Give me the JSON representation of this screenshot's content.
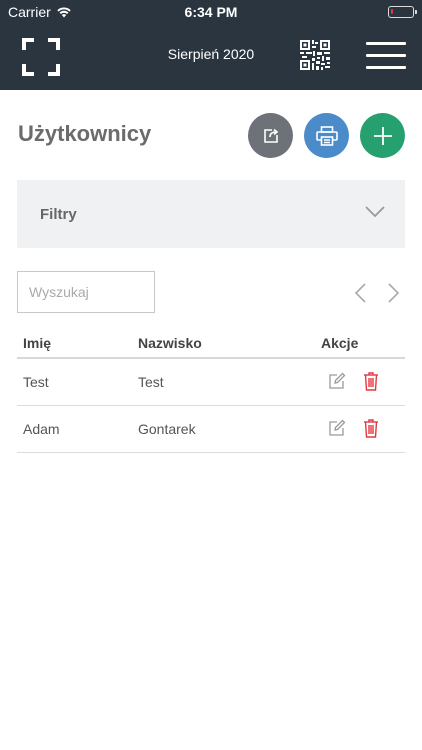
{
  "status_bar": {
    "carrier": "Carrier",
    "time": "6:34 PM",
    "battery_level": 0.1,
    "battery_color": "#e53935"
  },
  "header": {
    "title": "Sierpień 2020",
    "background": "#2b3540",
    "left_icon": "scan-frame-icon",
    "qr_icon": "qr-code-icon",
    "menu_icon": "hamburger-menu-icon"
  },
  "page": {
    "title": "Użytkownicy",
    "actions": [
      {
        "name": "export",
        "icon": "share-export-icon",
        "color": "#6d7279"
      },
      {
        "name": "print",
        "icon": "printer-icon",
        "color": "#4b8bc9"
      },
      {
        "name": "add",
        "icon": "plus-icon",
        "color": "#27a06f"
      }
    ]
  },
  "filters": {
    "label": "Filtry",
    "expanded": false
  },
  "search": {
    "placeholder": "Wyszukaj",
    "value": ""
  },
  "table": {
    "headers": {
      "first_name": "Imię",
      "last_name": "Nazwisko",
      "actions": "Akcje"
    },
    "rows": [
      {
        "first_name": "Test",
        "last_name": "Test"
      },
      {
        "first_name": "Adam",
        "last_name": "Gontarek"
      }
    ]
  }
}
